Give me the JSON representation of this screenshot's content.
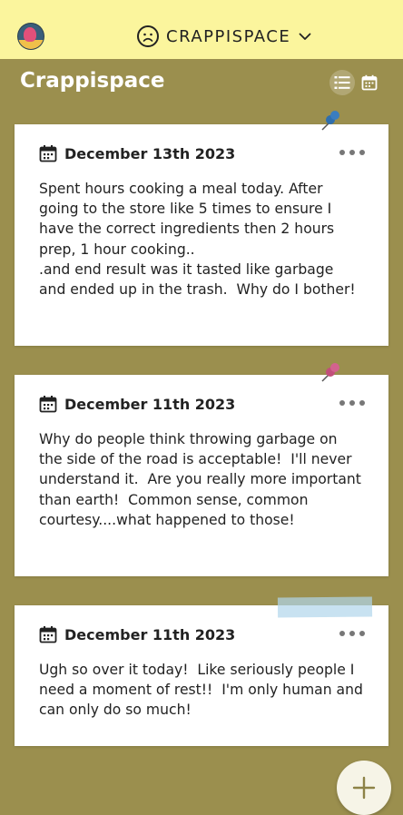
{
  "header": {
    "app_switcher_label": "CRAPPISPACE"
  },
  "page": {
    "title": "Crappispace"
  },
  "entries": [
    {
      "date": "December 13th 2023",
      "text": "Spent hours cooking a meal today. After going to the store like 5 times to ensure I have the correct ingredients then 2 hours prep, 1 hour cooking..\n.and end result was it tasted like garbage and ended up in the trash.  Why do I bother!",
      "decoration": "blue-pin"
    },
    {
      "date": "December 11th 2023",
      "text": "Why do people think throwing garbage on the side of the road is acceptable!  I'll never understand it.  Are you really more important than earth!  Common sense, common courtesy....what happened to those!",
      "decoration": "pink-pin"
    },
    {
      "date": "December 11th 2023",
      "text": "Ugh so over it today!  Like seriously people I need a moment of rest!!  I'm only human and can only do so much!",
      "decoration": "tape"
    }
  ],
  "icons": {
    "avatar": "avatar",
    "app_icon": "frown-face-icon",
    "dropdown": "chevron-down-icon",
    "list_view": "list-view-icon",
    "calendar_view": "calendar-view-icon",
    "entry_date": "calendar-icon",
    "entry_menu": "more-horizontal-icon",
    "add": "plus-icon"
  },
  "colors": {
    "header_bg": "#fbf59d",
    "page_bg": "#9b8f4e",
    "card_bg": "#ffffff",
    "blue_pin": "#2f6fae",
    "pink_pin": "#c95683",
    "tape": "#b0d6eb",
    "fab_bg": "#f6f4e7"
  }
}
